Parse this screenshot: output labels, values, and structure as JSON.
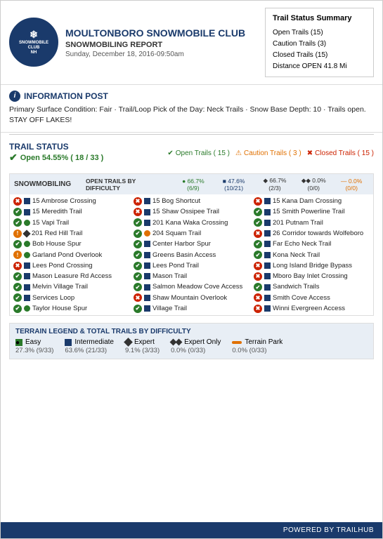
{
  "header": {
    "club_name": "MOULTONBORO SNOWMOBILE CLUB",
    "report_type": "SNOWMOBILING REPORT",
    "date": "Sunday, December 18, 2016-09:50am",
    "logo_lines": [
      "SNOWMOBILE",
      "CLUB",
      "NH"
    ]
  },
  "trail_summary": {
    "title": "Trail Status Summary",
    "open": "Open Trails (15)",
    "caution": "Caution Trails (3)",
    "closed": "Closed Trails (15)",
    "distance": "Distance OPEN 41.8 Mi"
  },
  "info_post": {
    "title": "INFORMATION POST",
    "text": "Primary Surface Condition: Fair · Trail/Loop Pick of the Day: Neck Trails · Snow Base Depth: 10 · Trails open. STAY OFF LAKES!"
  },
  "trail_status": {
    "title": "TRAIL STATUS",
    "open_pct": "Open 54.55% ( 18 / 33 )",
    "badges": {
      "open": "Open Trails ( 15 )",
      "caution": "Caution Trails ( 3 )",
      "closed": "Closed Trails ( 15 )"
    }
  },
  "snowmobiling": {
    "title": "SNOWMOBILING",
    "difficulty_header": "OPEN TRAILS BY DIFFICULTY",
    "difficulty_cols": [
      {
        "icon": "easy",
        "label": "66.7% (6/9)"
      },
      {
        "icon": "inter",
        "label": "47.6% (10/21)"
      },
      {
        "icon": "expert",
        "label": "66.7% (2/3)"
      },
      {
        "icon": "exponly",
        "label": "0.0% (0/0)"
      },
      {
        "icon": "terrain",
        "label": "0.0% (0/0)"
      }
    ],
    "trails_col1": [
      {
        "status": "closed",
        "diff": "inter",
        "name": "15 Ambrose Crossing"
      },
      {
        "status": "open",
        "diff": "inter",
        "name": "15 Meredith Trail"
      },
      {
        "status": "open",
        "diff": "easy",
        "name": "15 Vapi Trail"
      },
      {
        "status": "caution",
        "diff": "expert",
        "name": "201 Red Hill Trail"
      },
      {
        "status": "open",
        "diff": "easy",
        "name": "Bob House Spur"
      },
      {
        "status": "caution",
        "diff": "easy",
        "name": "Garland Pond Overlook"
      },
      {
        "status": "closed",
        "diff": "inter",
        "name": "Lees Pond Crossing"
      },
      {
        "status": "open",
        "diff": "inter",
        "name": "Mason Leasure Rd Access"
      },
      {
        "status": "open",
        "diff": "inter",
        "name": "Melvin Village Trail"
      },
      {
        "status": "open",
        "diff": "inter",
        "name": "Services Loop"
      },
      {
        "status": "open",
        "diff": "easy",
        "name": "Taylor House Spur"
      }
    ],
    "trails_col2": [
      {
        "status": "closed",
        "diff": "inter",
        "name": "15 Bog Shortcut"
      },
      {
        "status": "closed",
        "diff": "inter",
        "name": "15 Shaw Ossipee Trail"
      },
      {
        "status": "open",
        "diff": "inter",
        "name": "201 Kana Waka Crossing"
      },
      {
        "status": "open",
        "diff": "caution",
        "name": "204 Squam Trail"
      },
      {
        "status": "open",
        "diff": "inter",
        "name": "Center Harbor Spur"
      },
      {
        "status": "open",
        "diff": "inter",
        "name": "Greens Basin Access"
      },
      {
        "status": "open",
        "diff": "inter",
        "name": "Lees Pond Trail"
      },
      {
        "status": "open",
        "diff": "inter",
        "name": "Mason Trail"
      },
      {
        "status": "open",
        "diff": "inter",
        "name": "Salmon Meadow Cove Access"
      },
      {
        "status": "closed",
        "diff": "inter",
        "name": "Shaw Mountain Overlook"
      },
      {
        "status": "open",
        "diff": "inter",
        "name": "Village Trail"
      }
    ],
    "trails_col3": [
      {
        "status": "closed",
        "diff": "inter",
        "name": "15 Kana Dam Crossing"
      },
      {
        "status": "open",
        "diff": "inter",
        "name": "15 Smith Powerline Trail"
      },
      {
        "status": "open",
        "diff": "inter",
        "name": "201 Putnam Trail"
      },
      {
        "status": "closed",
        "diff": "inter",
        "name": "26 Corridor towards Wolfeboro"
      },
      {
        "status": "open",
        "diff": "inter",
        "name": "Far Echo Neck Trail"
      },
      {
        "status": "open",
        "diff": "inter",
        "name": "Kona Neck Trail"
      },
      {
        "status": "closed",
        "diff": "inter",
        "name": "Long Island Bridge Bypass"
      },
      {
        "status": "closed",
        "diff": "inter",
        "name": "Mboro Bay Inlet Crossing"
      },
      {
        "status": "open",
        "diff": "inter",
        "name": "Sandwich Trails"
      },
      {
        "status": "closed",
        "diff": "inter",
        "name": "Smith Cove Access"
      },
      {
        "status": "closed",
        "diff": "inter",
        "name": "Winni Evergreen Access"
      }
    ]
  },
  "legend": {
    "title": "TERRAIN LEGEND & TOTAL TRAILS by DIFFICULTY",
    "items": [
      {
        "icon": "easy",
        "label": "Easy",
        "pct": "27.3% (9/33)"
      },
      {
        "icon": "inter",
        "label": "Intermediate",
        "pct": "63.6% (21/33)"
      },
      {
        "icon": "expert",
        "label": "Expert",
        "pct": "9.1% (3/33)"
      },
      {
        "icon": "exponly",
        "label": "Expert Only",
        "pct": "0.0% (0/33)"
      },
      {
        "icon": "terrain",
        "label": "Terrain Park",
        "pct": "0.0% (0/33)"
      }
    ]
  },
  "footer": {
    "text": "POWERED BY TRAILHUB"
  }
}
